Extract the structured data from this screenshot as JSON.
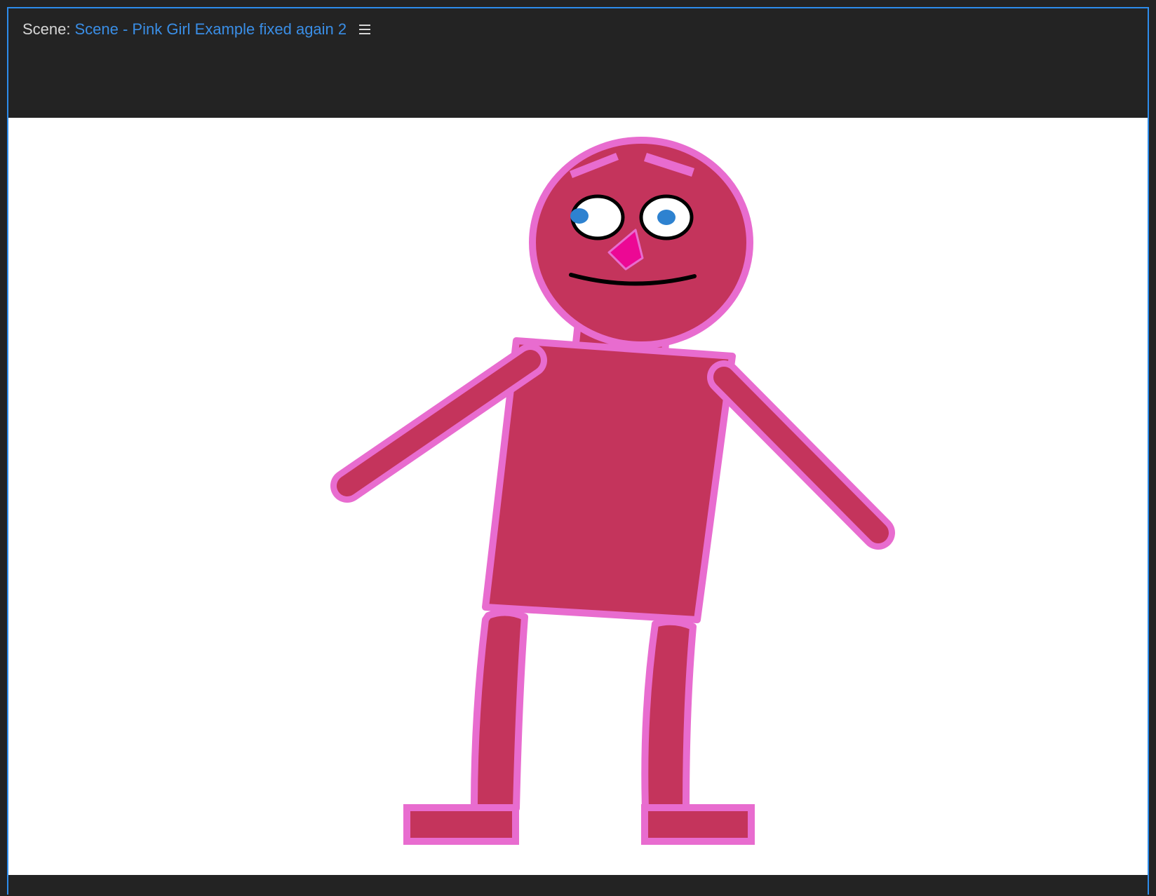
{
  "panel": {
    "scene_label": "Scene:",
    "scene_name": "Scene - Pink Girl Example fixed again 2",
    "menu_icon": "hamburger-menu-icon"
  },
  "colors": {
    "accent": "#3a8ee6",
    "panel_background": "#232323",
    "stage_background": "#ffffff",
    "puppet_fill": "#c4345c",
    "puppet_outline": "#e86ccf",
    "nose_fill": "#ec0894",
    "pupil": "#2e82d0"
  }
}
